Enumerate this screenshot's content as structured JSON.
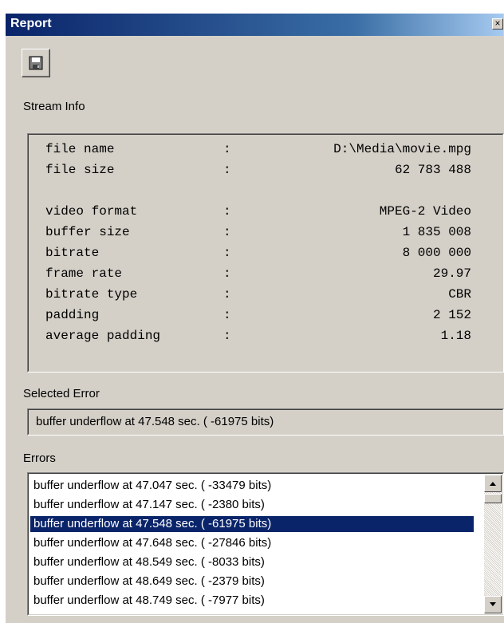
{
  "window": {
    "title": "Report",
    "close_glyph": "×"
  },
  "toolbar": {
    "save_icon": "floppy-disk-icon"
  },
  "stream_info": {
    "label": "Stream Info",
    "rows": [
      {
        "key": "file name",
        "colon": ":",
        "value": "D:\\Media\\movie.mpg"
      },
      {
        "key": "file size",
        "colon": ":",
        "value": "62 783 488"
      },
      {
        "key": "",
        "colon": "",
        "value": ""
      },
      {
        "key": "video format",
        "colon": ":",
        "value": "MPEG-2 Video"
      },
      {
        "key": "buffer size",
        "colon": ":",
        "value": "1 835 008"
      },
      {
        "key": "bitrate",
        "colon": ":",
        "value": "8 000 000"
      },
      {
        "key": "frame rate",
        "colon": ":",
        "value": "29.97"
      },
      {
        "key": "bitrate type",
        "colon": ":",
        "value": "CBR"
      },
      {
        "key": "padding",
        "colon": ":",
        "value": "2 152"
      },
      {
        "key": "average padding",
        "colon": ":",
        "value": "1.18"
      }
    ]
  },
  "selected_error": {
    "label": "Selected Error",
    "value": "buffer underflow at 47.548 sec. ( -61975 bits)"
  },
  "errors": {
    "label": "Errors",
    "selected_index": 2,
    "items": [
      "buffer underflow at 47.047 sec. ( -33479 bits)",
      "buffer underflow at 47.147 sec. ( -2380 bits)",
      "buffer underflow at 47.548 sec. ( -61975 bits)",
      "buffer underflow at 47.648 sec. ( -27846 bits)",
      "buffer underflow at 48.549 sec. ( -8033 bits)",
      "buffer underflow at 48.649 sec. ( -2379 bits)",
      "buffer underflow at 48.749 sec. ( -7977 bits)"
    ]
  }
}
